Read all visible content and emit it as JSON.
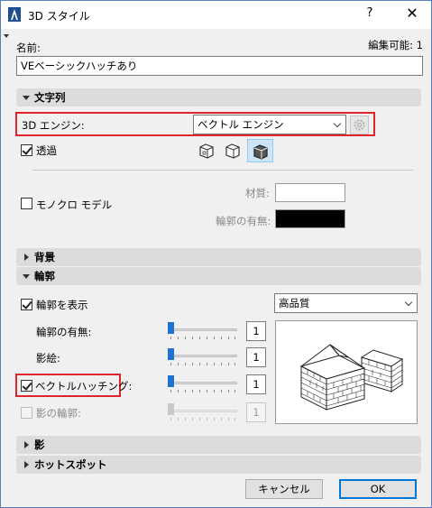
{
  "window": {
    "title": "3D スタイル",
    "help": "?",
    "close": "✕"
  },
  "name": {
    "label": "名前:",
    "editable_label": "編集可能: 1",
    "value": "VEベーシックハッチあり"
  },
  "sections": {
    "string": "文字列",
    "background": "背景",
    "outline": "輪郭",
    "shadow": "影",
    "hotspot": "ホットスポット"
  },
  "engine": {
    "label": "3D エンジン:",
    "value": "ベクトル エンジン"
  },
  "transparent": {
    "label": "透過",
    "checked": true
  },
  "mono": {
    "label": "モノクロ モデル",
    "checked": false,
    "material_label": "材質:",
    "outline_label": "輪郭の有無:",
    "material_color": "#ffffff",
    "outline_color": "#000000"
  },
  "outline": {
    "show_label": "輪郭を表示",
    "show_checked": true,
    "quality": "高品質",
    "contour_label": "輪郭の有無:",
    "contour_value": "1",
    "shading_label": "影絵:",
    "shading_value": "1",
    "vector_hatch_label": "ベクトルハッチング:",
    "vector_hatch_checked": true,
    "vector_hatch_value": "1",
    "shadow_outline_label": "影の輪郭:",
    "shadow_outline_value": "1"
  },
  "buttons": {
    "cancel": "キャンセル",
    "ok": "OK"
  },
  "colors": {
    "accent": "#1e73d2",
    "highlight_red": "#e0242c"
  }
}
